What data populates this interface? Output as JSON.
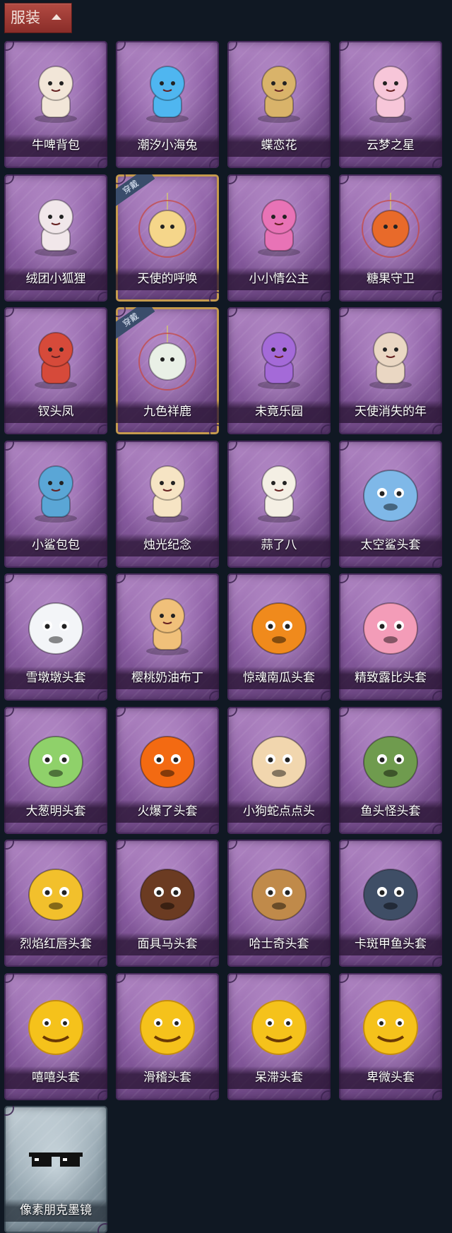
{
  "header": {
    "title": "服装",
    "toggle_icon": "chevron-up-icon"
  },
  "items": [
    {
      "name": "牛啤背包",
      "icon": "cow-barrel-backpack",
      "color": "#f2e6d8"
    },
    {
      "name": "潮汐小海兔",
      "icon": "blue-sea-bunny",
      "color": "#4fb6f0"
    },
    {
      "name": "蝶恋花",
      "icon": "butterfly-flower-wreath",
      "color": "#d9b36a"
    },
    {
      "name": "云梦之星",
      "icon": "unicorn-cloud-star",
      "color": "#f7c6d9"
    },
    {
      "name": "绒团小狐狸",
      "icon": "fluffy-fox",
      "color": "#f1e7ea"
    },
    {
      "name": "天使的呼唤",
      "icon": "angel-charm",
      "color": "#f5d68a",
      "equipped": true,
      "badge": "穿戴"
    },
    {
      "name": "小小情公主",
      "icon": "pink-princess",
      "color": "#e873b6"
    },
    {
      "name": "糖果守卫",
      "icon": "pumpkin-guard-charm",
      "color": "#e86a2a"
    },
    {
      "name": "钗头凤",
      "icon": "phoenix-crown-doll",
      "color": "#d64a3a"
    },
    {
      "name": "九色祥鹿",
      "icon": "nine-color-deer-charm",
      "color": "#e9f0e6",
      "equipped": true,
      "badge": "穿戴"
    },
    {
      "name": "未竟乐园",
      "icon": "purple-hair-girl",
      "color": "#a46ad8"
    },
    {
      "name": "天使消失的年",
      "icon": "halo-girl",
      "color": "#ead7c3"
    },
    {
      "name": "小鲨包包",
      "icon": "shark-bag",
      "color": "#5aa6d6"
    },
    {
      "name": "烛光纪念",
      "icon": "candle",
      "color": "#f6e4c4"
    },
    {
      "name": "蒜了八",
      "icon": "garlic",
      "color": "#f4efe4"
    },
    {
      "name": "太空鲨头套",
      "icon": "space-shark-head",
      "color": "#7fb8e8"
    },
    {
      "name": "雪墩墩头套",
      "icon": "snowman-head",
      "color": "#f3f5f8"
    },
    {
      "name": "樱桃奶油布丁",
      "icon": "pudding",
      "color": "#f0c07a"
    },
    {
      "name": "惊魂南瓜头套",
      "icon": "pumpkin-head",
      "color": "#f08a1c"
    },
    {
      "name": "精致露比头套",
      "icon": "pink-beaver-head",
      "color": "#f39cb8"
    },
    {
      "name": "大葱明头套",
      "icon": "green-onion-head",
      "color": "#8fd16a"
    },
    {
      "name": "火爆了头套",
      "icon": "fire-head",
      "color": "#f36a12"
    },
    {
      "name": "小狗蛇点点头",
      "icon": "puppy-snake-head",
      "color": "#f1d6ae"
    },
    {
      "name": "鱼头怪头套",
      "icon": "fish-head",
      "color": "#6f9b4e"
    },
    {
      "name": "烈焰红唇头套",
      "icon": "yellow-mouse-head",
      "color": "#f2c02c"
    },
    {
      "name": "面具马头套",
      "icon": "horse-head",
      "color": "#6b3b22"
    },
    {
      "name": "哈士奇头套",
      "icon": "husky-head",
      "color": "#c08a4a"
    },
    {
      "name": "卡斑甲鱼头套",
      "icon": "catfish-head",
      "color": "#3f4e66"
    },
    {
      "name": "嘻嘻头套",
      "icon": "grin-emoji-head",
      "color": "#f5c21b"
    },
    {
      "name": "滑稽头套",
      "icon": "funny-emoji-head",
      "color": "#f5c21b"
    },
    {
      "name": "呆滞头套",
      "icon": "stare-emoji-head",
      "color": "#f5c21b"
    },
    {
      "name": "卑微头套",
      "icon": "humble-emoji-head",
      "color": "#f5c21b"
    },
    {
      "name": "像素朋克墨镜",
      "icon": "pixel-sunglasses",
      "color": "#111111",
      "gray": true
    }
  ]
}
